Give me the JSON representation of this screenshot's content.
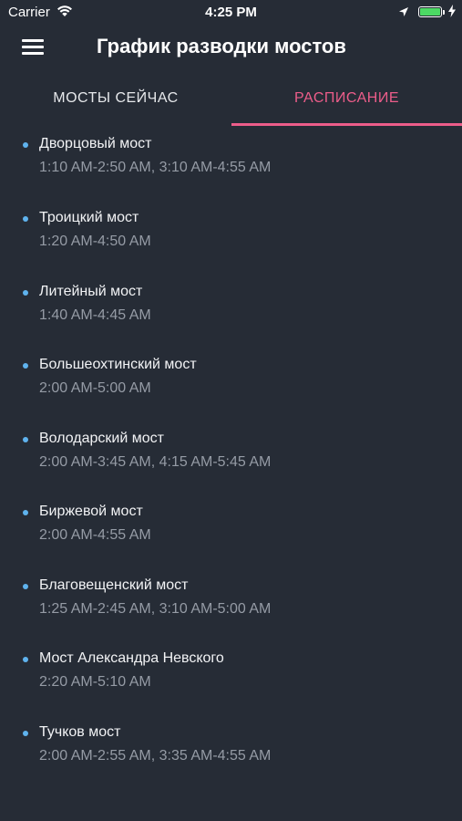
{
  "status_bar": {
    "carrier": "Carrier",
    "time": "4:25 PM",
    "battery_level": 1.0,
    "battery_color": "#4cd964"
  },
  "header": {
    "title": "График разводки мостов",
    "menu_icon": "hamburger-menu-icon"
  },
  "tabs": [
    {
      "label": "МОСТЫ СЕЙЧАС",
      "active": false
    },
    {
      "label": "РАСПИСАНИЕ",
      "active": true
    }
  ],
  "colors": {
    "background": "#262c36",
    "accent": "#ec5d8a",
    "bullet": "#5fb3ee",
    "secondary_text": "#959ba5"
  },
  "bridges": [
    {
      "name": "Дворцовый мост",
      "times": "1:10 AM-2:50 AM, 3:10 AM-4:55 AM"
    },
    {
      "name": "Троицкий мост",
      "times": "1:20 AM-4:50 AM"
    },
    {
      "name": "Литейный мост",
      "times": "1:40 AM-4:45 AM"
    },
    {
      "name": "Большеохтинский мост",
      "times": "2:00 AM-5:00 AM"
    },
    {
      "name": "Володарский мост",
      "times": "2:00 AM-3:45 AM, 4:15 AM-5:45 AM"
    },
    {
      "name": "Биржевой мост",
      "times": "2:00 AM-4:55 AM"
    },
    {
      "name": "Благовещенский мост",
      "times": "1:25 AM-2:45 AM, 3:10 AM-5:00 AM"
    },
    {
      "name": "Мост Александра Невского",
      "times": "2:20 AM-5:10 AM"
    },
    {
      "name": "Тучков мост",
      "times": "2:00 AM-2:55 AM, 3:35 AM-4:55 AM"
    }
  ]
}
